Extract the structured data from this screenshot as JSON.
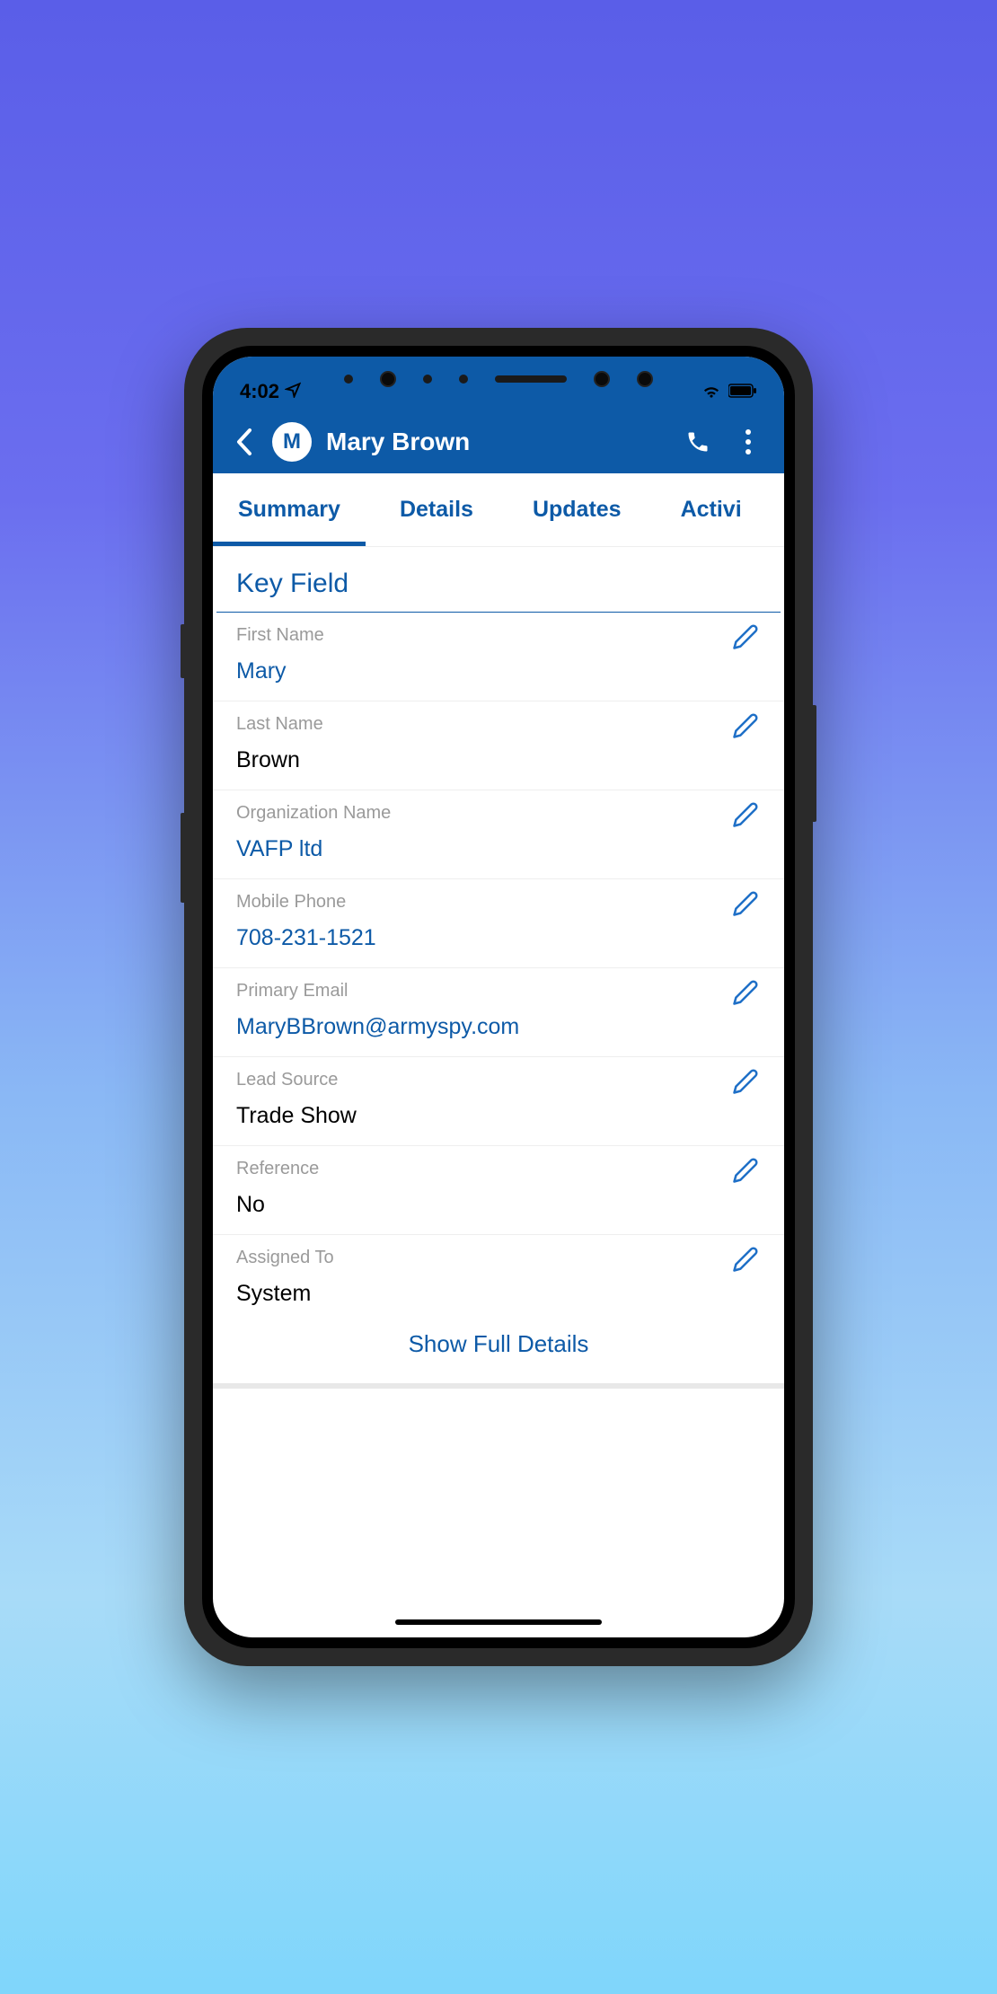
{
  "status": {
    "time": "4:02"
  },
  "header": {
    "avatar_initial": "M",
    "title": "Mary Brown"
  },
  "tabs": [
    {
      "label": "Summary",
      "active": true
    },
    {
      "label": "Details",
      "active": false
    },
    {
      "label": "Updates",
      "active": false
    },
    {
      "label": "Activi",
      "active": false
    }
  ],
  "section": {
    "title": "Key Field"
  },
  "fields": [
    {
      "label": "First Name",
      "value": "Mary",
      "link": true
    },
    {
      "label": "Last Name",
      "value": "Brown",
      "link": false
    },
    {
      "label": "Organization Name",
      "value": "VAFP ltd",
      "link": true
    },
    {
      "label": "Mobile Phone",
      "value": "708-231-1521",
      "link": true
    },
    {
      "label": "Primary Email",
      "value": "MaryBBrown@armyspy.com",
      "link": true
    },
    {
      "label": "Lead Source",
      "value": "Trade Show",
      "link": false
    },
    {
      "label": "Reference",
      "value": "No",
      "link": false
    },
    {
      "label": "Assigned To",
      "value": "System",
      "link": false
    }
  ],
  "show_full": "Show Full Details"
}
